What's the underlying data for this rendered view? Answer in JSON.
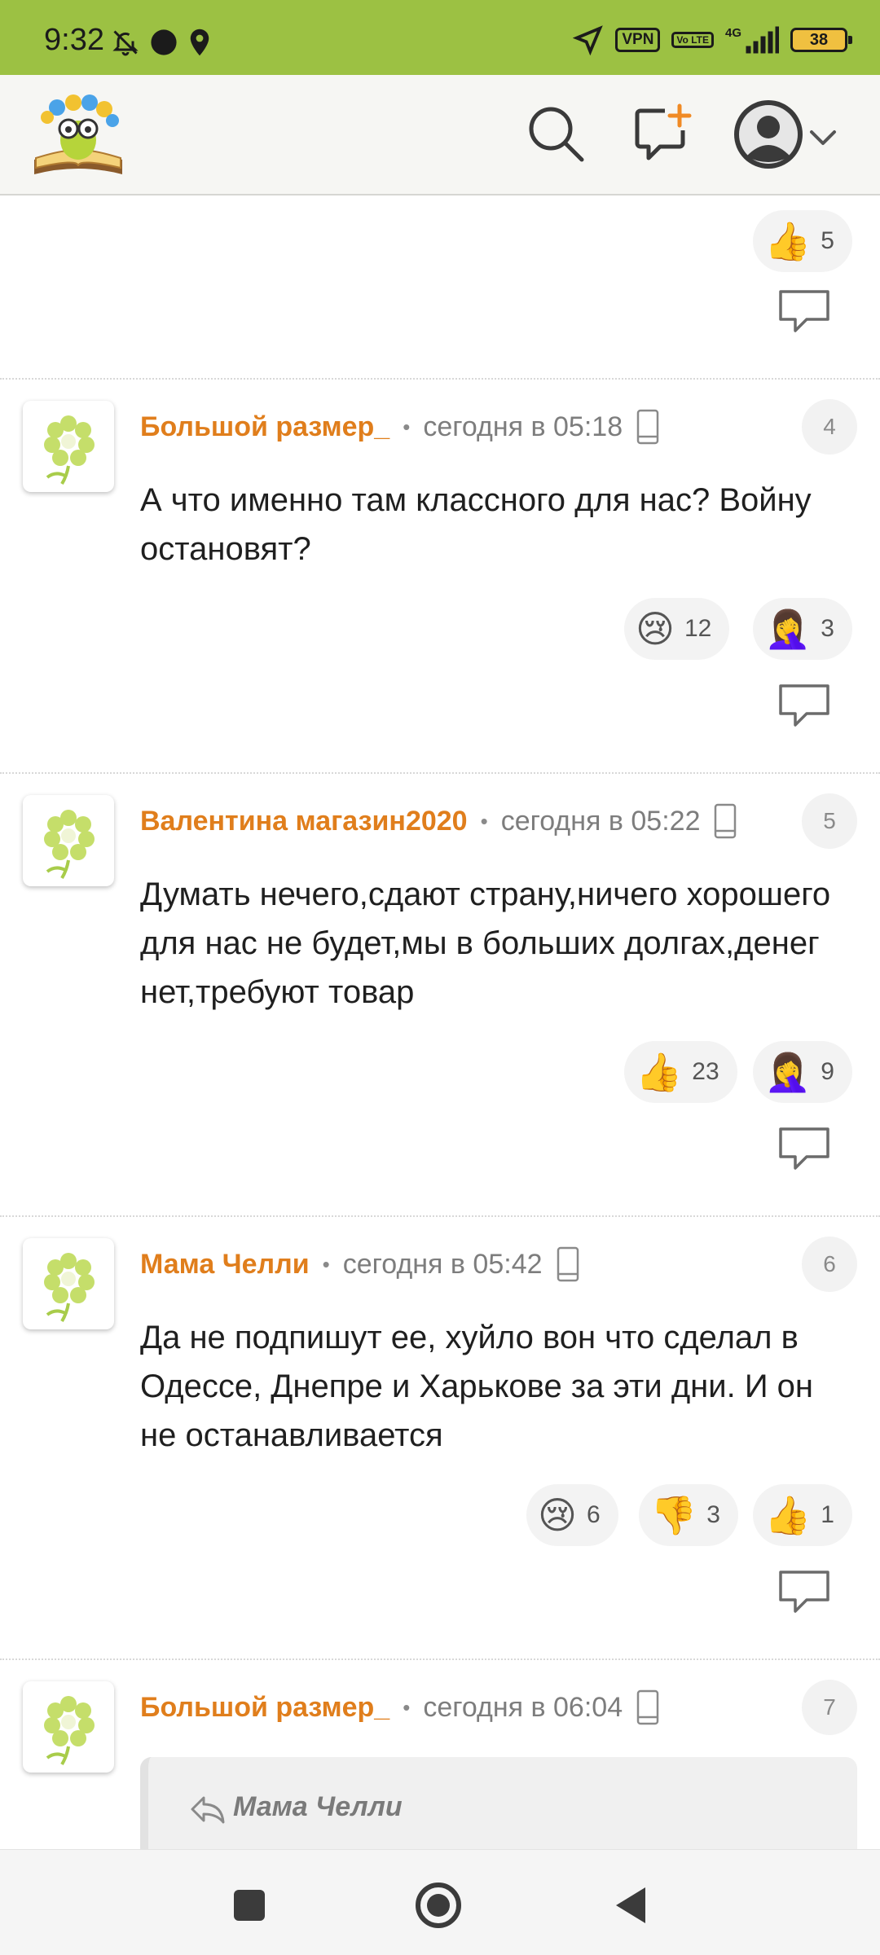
{
  "status_bar": {
    "time": "9:32",
    "vpn": "VPN",
    "volte": "Vo LTE",
    "network": "4G",
    "battery": "38",
    "icons": [
      "bell-off-icon",
      "dot-icon",
      "location-pin-icon",
      "navigation-arrow-icon",
      "signal-icon"
    ]
  },
  "header": {
    "logo_icon": "bookworm-logo-icon",
    "search_icon": "search-icon",
    "new_post_icon": "new-post-icon",
    "profile_icon": "profile-avatar-icon",
    "menu_icon": "chevron-down-icon"
  },
  "top_partial": {
    "reactions": [
      {
        "emoji": "👍",
        "count": "5"
      }
    ],
    "reply_icon": "reply-speech-bubble-icon"
  },
  "comments": [
    {
      "number": "4",
      "author": "Большой размер_",
      "time": "сегодня в 05:18",
      "device_icon": "mobile-phone-icon",
      "text": "А что именно там классного для нас? Войну остановят?",
      "reactions": [
        {
          "emoji": "😢",
          "count": "12"
        },
        {
          "emoji": "🤦‍♀️",
          "count": "3"
        }
      ]
    },
    {
      "number": "5",
      "author": "Валентина магазин2020",
      "time": "сегодня в 05:22",
      "device_icon": "mobile-phone-icon",
      "text": "Думать нечего,сдают страну,ничего хорошего для нас не будет,мы в больших долгах,денег нет,требуют товар",
      "reactions": [
        {
          "emoji": "👍",
          "count": "23"
        },
        {
          "emoji": "🤦‍♀️",
          "count": "9"
        }
      ]
    },
    {
      "number": "6",
      "author": "Мама Челли",
      "time": "сегодня в 05:42",
      "device_icon": "mobile-phone-icon",
      "text": "Да не подпишут ее, хуйло вон что сделал в Одессе, Днепре и Харькове за эти дни. И он не останавливается",
      "reactions": [
        {
          "emoji": "😢",
          "count": "6"
        },
        {
          "emoji": "👎",
          "count": "3"
        },
        {
          "emoji": "👍",
          "count": "1"
        }
      ]
    },
    {
      "number": "7",
      "author": "Большой размер_",
      "time": "сегодня в 06:04",
      "device_icon": "mobile-phone-icon",
      "quote_author": "Мама Челли"
    }
  ],
  "nav": {
    "recents_icon": "square-recents-icon",
    "home_icon": "circle-home-icon",
    "back_icon": "triangle-back-icon"
  },
  "colors": {
    "status_bar": "#9cc143",
    "author": "#e07e1c",
    "header_bg": "#f6f6f3"
  }
}
